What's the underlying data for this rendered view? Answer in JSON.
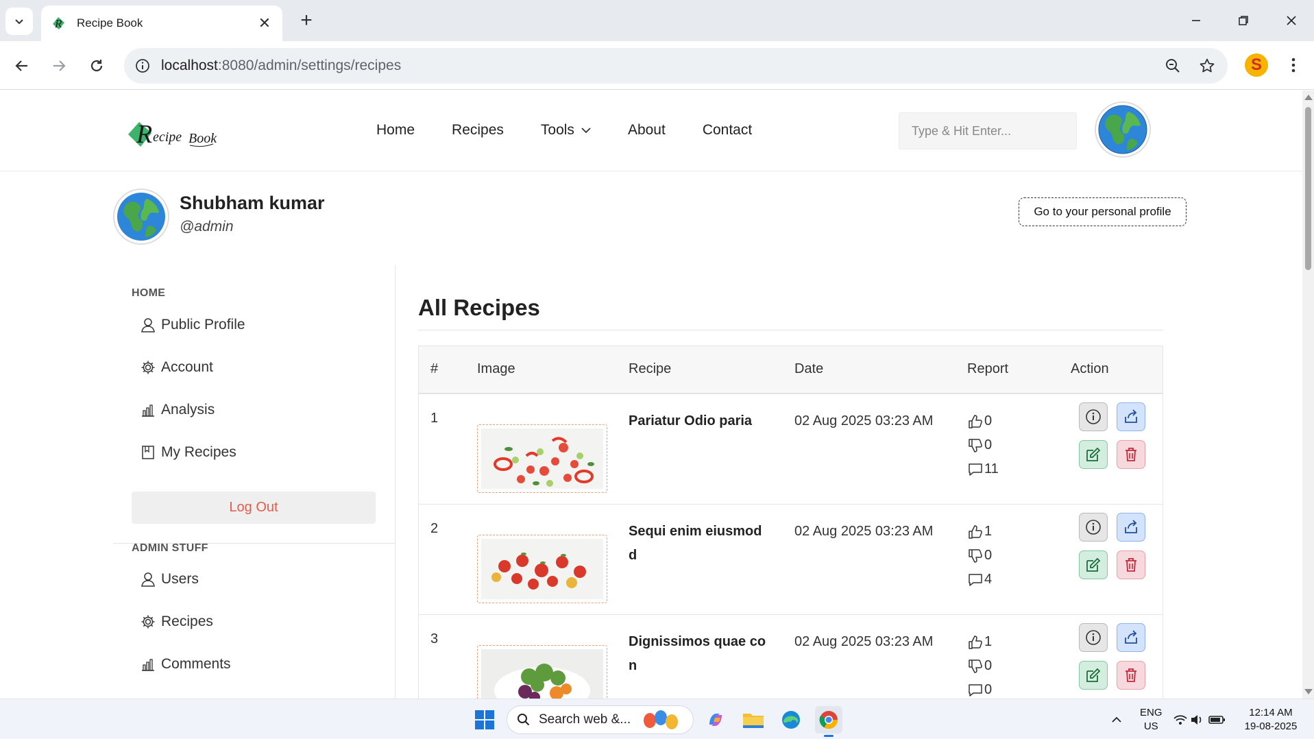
{
  "browser": {
    "tab_title": "Recipe Book",
    "url_host": "localhost",
    "url_rest": ":8080/admin/settings/recipes"
  },
  "site": {
    "logo_text": "Recipe Book",
    "nav": [
      {
        "label": "Home"
      },
      {
        "label": "Recipes"
      },
      {
        "label": "Tools"
      },
      {
        "label": "About"
      },
      {
        "label": "Contact"
      }
    ],
    "search_placeholder": "Type & Hit Enter..."
  },
  "profile": {
    "name": "Shubham kumar",
    "handle": "@admin",
    "personal_button": "Go to your personal profile"
  },
  "sidebar": {
    "home_heading": "HOME",
    "home_items": [
      {
        "label": "Public Profile",
        "icon": "user-icon"
      },
      {
        "label": "Account",
        "icon": "gear-icon"
      },
      {
        "label": "Analysis",
        "icon": "bar-chart-icon"
      },
      {
        "label": "My Recipes",
        "icon": "book-icon"
      }
    ],
    "logout_label": "Log Out",
    "admin_heading": "ADMIN STUFF",
    "admin_items": [
      {
        "label": "Users",
        "icon": "user-icon"
      },
      {
        "label": "Recipes",
        "icon": "gear-icon"
      },
      {
        "label": "Comments",
        "icon": "bar-chart-icon"
      }
    ]
  },
  "content": {
    "title": "All Recipes",
    "columns": [
      "#",
      "Image",
      "Recipe",
      "Date",
      "Report",
      "Action"
    ],
    "rows": [
      {
        "num": "1",
        "recipe": "Pariatur Odio paria",
        "date": "02 Aug 2025 03:23 AM",
        "likes": "0",
        "dislikes": "0",
        "comments": "11",
        "image": "sliced-vegetables"
      },
      {
        "num": "2",
        "recipe": "Sequi enim eiusmod d",
        "date": "02 Aug 2025 03:23 AM",
        "likes": "1",
        "dislikes": "0",
        "comments": "4",
        "image": "red-apples"
      },
      {
        "num": "3",
        "recipe": "Dignissimos quae con",
        "date": "02 Aug 2025 03:23 AM",
        "likes": "1",
        "dislikes": "0",
        "comments": "0",
        "image": "salad-bowl"
      }
    ]
  },
  "taskbar": {
    "search_text": "Search web &...",
    "lang_top": "ENG",
    "lang_bottom": "US",
    "time": "12:14 AM",
    "date": "19-08-2025"
  },
  "colors": {
    "accent_logout": "#e25b4b",
    "info_bg": "#e6e6e6",
    "share_bg": "#d3e3fb",
    "edit_bg": "#d3eedf",
    "delete_bg": "#f7d8dc"
  }
}
